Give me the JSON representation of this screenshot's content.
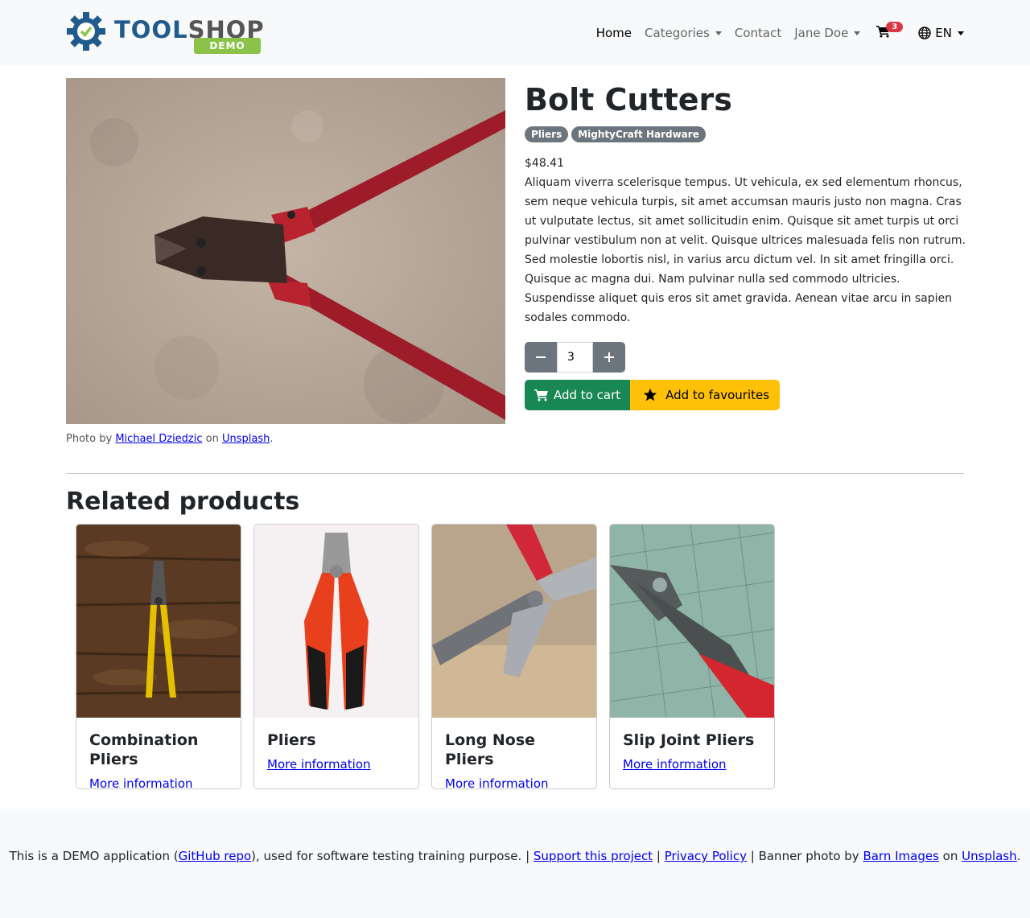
{
  "nav": {
    "logo_text_1": "TOOL",
    "logo_text_2": "SHOP",
    "logo_demo": "DEMO",
    "home": "Home",
    "categories": "Categories",
    "contact": "Contact",
    "user": "Jane Doe",
    "cart_count": "3",
    "lang": "EN"
  },
  "product": {
    "title": "Bolt Cutters",
    "badges": [
      "Pliers",
      "MightyCraft Hardware"
    ],
    "price": "$48.41",
    "description": "Aliquam viverra scelerisque tempus. Ut vehicula, ex sed elementum rhoncus, sem neque vehicula turpis, sit amet accumsan mauris justo non magna. Cras ut vulputate lectus, sit amet sollicitudin enim. Quisque sit amet turpis ut orci pulvinar vestibulum non at velit. Quisque ultrices malesuada felis non rutrum. Sed molestie lobortis nisl, in varius arcu dictum vel. In sit amet fringilla orci. Quisque ac magna dui. Nam pulvinar nulla sed commodo ultricies. Suspendisse aliquet quis eros sit amet gravida. Aenean vitae arcu in sapien sodales commodo.",
    "quantity": "3",
    "add_to_cart": "Add to cart",
    "add_to_favourites": "Add to favourites",
    "photo_credit_prefix": "Photo by",
    "photo_author": "Michael Dziedzic",
    "photo_on": "on",
    "photo_source": "Unsplash",
    "photo_suffix": "."
  },
  "related": {
    "title": "Related products",
    "more_info": "More information",
    "items": [
      {
        "name": "Combination Pliers"
      },
      {
        "name": "Pliers"
      },
      {
        "name": "Long Nose Pliers"
      },
      {
        "name": "Slip Joint Pliers"
      }
    ]
  },
  "footer": {
    "t1": "This is a DEMO application (",
    "github": "GitHub repo",
    "t2": "), used for software testing training purpose. | ",
    "support": "Support this project",
    "sep": " | ",
    "privacy": "Privacy Policy",
    "t3": " | Banner photo by ",
    "barn": "Barn Images",
    "t4": " on ",
    "unsplash": "Unsplash",
    "t5": "."
  },
  "colors": {
    "nav_bg": "#f8f9fa",
    "cart_button": "#198754",
    "fav_button": "#ffc107",
    "qty_button": "#6c757d",
    "badge": "#6c757d",
    "cart_badge": "#dc3545"
  }
}
